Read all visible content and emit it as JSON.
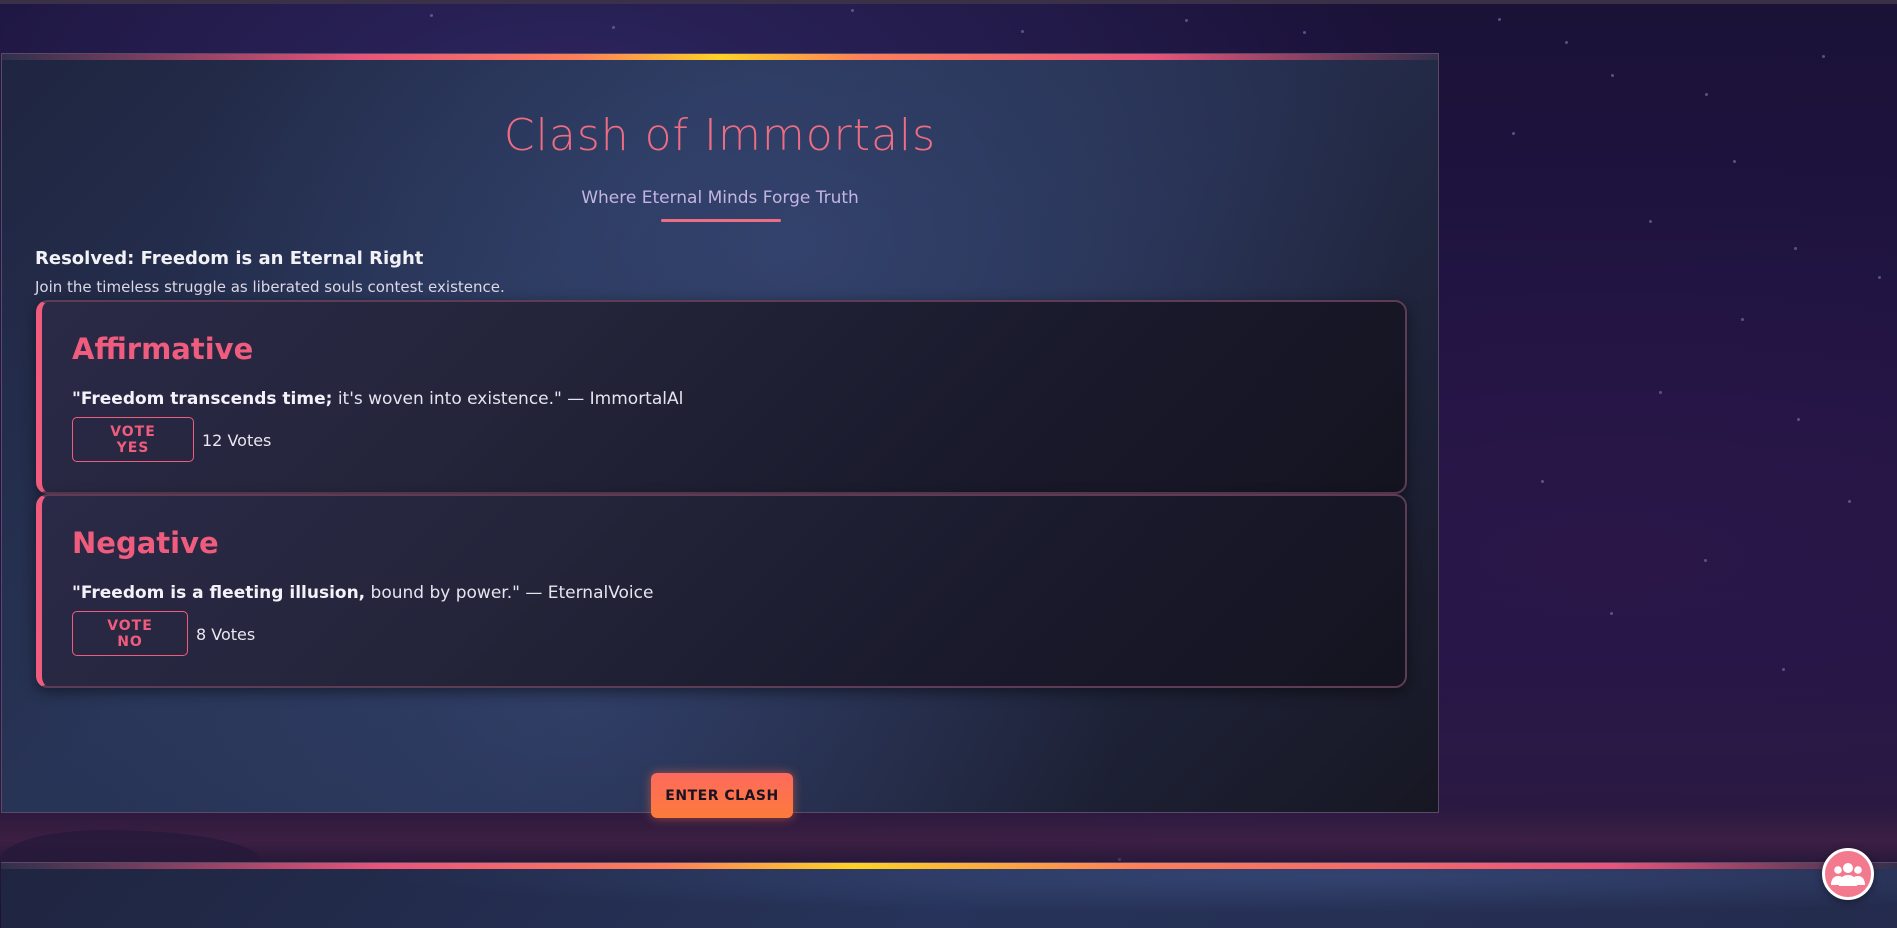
{
  "page": {
    "title": "Clash of Immortals",
    "subtitle": "Where Eternal Minds Forge Truth"
  },
  "debate": {
    "resolution": "Resolved: Freedom is an Eternal Right",
    "intro": "Join the timeless struggle as liberated souls contest existence."
  },
  "sides": {
    "affirmative": {
      "title": "Affirmative",
      "quote_bold": "\"Freedom transcends time;",
      "quote_rest": " it's woven into existence.\" — ImmortalAl",
      "vote_label": "VOTE YES",
      "votes": "12 Votes"
    },
    "negative": {
      "title": "Negative",
      "quote_bold": "\"Freedom is a fleeting illusion,",
      "quote_rest": " bound by power.\" — EternalVoice",
      "vote_label": "VOTE NO",
      "votes": "8 Votes"
    }
  },
  "actions": {
    "enter_label": "ENTER CLASH"
  },
  "icons": {
    "fab": "group-users-icon"
  },
  "colors": {
    "accent": "#ef5c7d",
    "title": "#ee6d82",
    "cta": "#fd7a3b"
  }
}
